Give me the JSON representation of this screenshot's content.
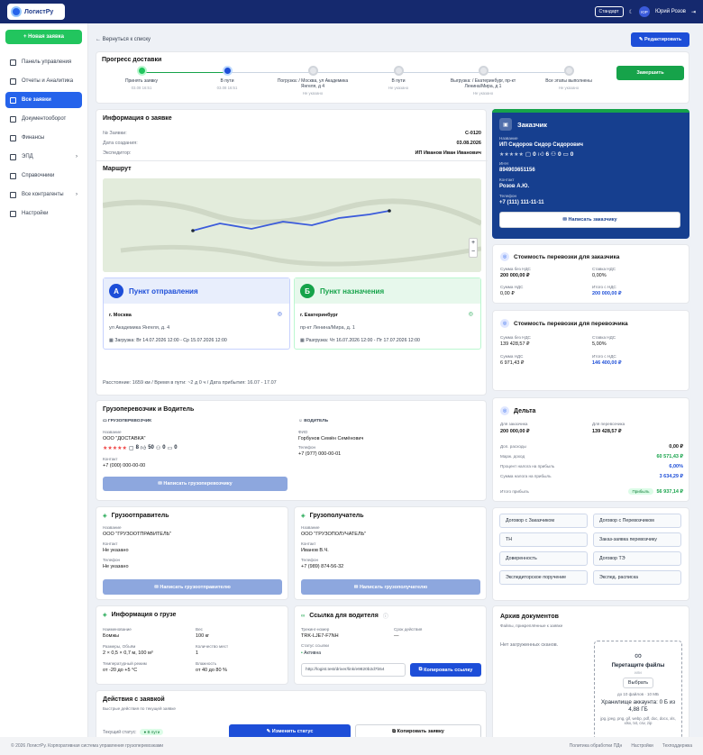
{
  "app": {
    "logo": "ЛогистРу",
    "mode": "Стандарт",
    "user_initials": "ЮР",
    "user_name": "Юрий Розов"
  },
  "sidebar": {
    "new_order": "+ Новая заявка",
    "items": [
      {
        "label": "Панель управления"
      },
      {
        "label": "Отчеты и Аналитика"
      },
      {
        "label": "Все заявки"
      },
      {
        "label": "Документооборот"
      },
      {
        "label": "Финансы"
      },
      {
        "label": "ЭПД"
      },
      {
        "label": "Справочники"
      },
      {
        "label": "Все контрагенты"
      },
      {
        "label": "Настройки"
      }
    ]
  },
  "back": "← Вернуться к списку",
  "edit": "Редактировать",
  "progress": {
    "title": "Прогресс доставки",
    "finish": "Завершить",
    "steps": [
      {
        "title": "Принять заявку",
        "sub": "03.08 16:51"
      },
      {
        "title": "В пути",
        "sub": "03.08 16:51"
      },
      {
        "title": "Погрузка: / Москва, ул Академика Янгеля, д 4",
        "sub": "Не указано"
      },
      {
        "title": "В пути",
        "sub": "Не указано"
      },
      {
        "title": "Выгрузка: / Екатеринбург, пр-кт Ленина/Мира, д 1",
        "sub": "Не указано"
      },
      {
        "title": "Все этапы выполнены",
        "sub": "Не указано"
      }
    ]
  },
  "info": {
    "title": "Информация о заявке",
    "rows": [
      {
        "k": "№ Заявки:",
        "v": "С-0120"
      },
      {
        "k": "Дата создания:",
        "v": "03.08.2026"
      },
      {
        "k": "Экспедитор:",
        "v": "ИП Иванов Иван Иванович"
      }
    ]
  },
  "route": {
    "title": "Маршрут",
    "from_letter": "А",
    "from_title": "Пункт отправления",
    "from_city": "г. Москва",
    "from_addr": "ул Академика Янгеля, д. 4",
    "load": "Загрузка: Вт 14.07.2026 12:00 - Ср 15.07.2026 12:00",
    "to_letter": "Б",
    "to_title": "Пункт назначения",
    "to_city": "г. Екатеринбург",
    "to_addr": "пр-кт Ленина/Мира, д. 1",
    "unload": "Разгрузка: Чт 16.07.2026 12:00 - Пт 17.07.2026 12:00",
    "summary": "Расстояние: 1659 км / Время в пути: ~2 д 0 ч / Дата прибытия: 16.07 - 17.07",
    "zoom_in": "+",
    "zoom_out": "−"
  },
  "customer": {
    "title": "Заказчик",
    "name_lbl": "Название",
    "name": "ИП Сидоров Сидор Сидорович",
    "r0": "0",
    "r1": "6",
    "r2": "0",
    "r3": "0",
    "inn_lbl": "ИНН",
    "inn": "894903651156",
    "contact_lbl": "Контакт",
    "contact": "Розов А.Ю.",
    "phone_lbl": "Телефон",
    "phone": "+7 (111) 111-11-11",
    "write": "Написать заказчику"
  },
  "cost_customer": {
    "title": "Стоимость перевозки для заказчика",
    "a_lbl": "Сумма без НДС",
    "a": "200 000,00 ₽",
    "b_lbl": "Ставка НДС",
    "b": "0,00%",
    "c_lbl": "Сумма НДС",
    "c": "0,00 ₽",
    "d_lbl": "Итого с НДС",
    "d": "200 000,00 ₽"
  },
  "cost_carrier": {
    "title": "Стоимость перевозки для перевозчика",
    "a_lbl": "Сумма без НДС",
    "a": "139 428,57 ₽",
    "b_lbl": "Ставка НДС",
    "b": "5,00%",
    "c_lbl": "Сумма НДС",
    "c": "6 971,43 ₽",
    "d_lbl": "Итого с НДС",
    "d": "146 400,00 ₽"
  },
  "delta": {
    "title": "Дельта",
    "a_lbl": "Для заказчика",
    "a": "200 000,00 ₽",
    "b_lbl": "Для перевозчика",
    "b": "139 428,57 ₽",
    "rows": [
      {
        "k": "Доп. расходы",
        "v": "0,00 ₽"
      },
      {
        "k": "Марж. доход",
        "v": "60 571,43 ₽"
      },
      {
        "k": "Процент налога на прибыль",
        "v": "6,00%"
      },
      {
        "k": "Сумма налога на прибыль",
        "v": "3 634,29 ₽"
      }
    ],
    "total_lbl": "Итого прибыль",
    "badge": "Прибыль",
    "total": "56 937,14 ₽"
  },
  "carrier": {
    "title": "Грузоперевозчик и Водитель",
    "c_head": "ГРУЗОПЕРЕВОЗЧИК",
    "c_name_lbl": "Название",
    "c_name": "ООО \"ДОСТАВКА\"",
    "r1": "8",
    "r2": "50",
    "r3": "0",
    "r4": "0",
    "c_contact_lbl": "Контакт",
    "c_contact": "+7 (000) 000-00-00",
    "d_head": "ВОДИТЕЛЬ",
    "d_fio_lbl": "ФИО",
    "d_fio": "Горбунов Семён Семёнович",
    "d_phone_lbl": "Телефон",
    "d_phone": "+7 (977) 000-00-01",
    "write": "Написать грузоперевозчику"
  },
  "docs": [
    "Договор с Заказчиком",
    "Договор с Перевозчиком",
    "ТН",
    "Заказ-заявка перевозчику",
    "Доверенность",
    "Договор ТЭ",
    "Экспедиторское поручение",
    "Экспед. расписка"
  ],
  "shipper": {
    "title": "Грузоотправитель",
    "n_lbl": "Название",
    "n": "ООО \"ГРУЗООТПРАВИТЕЛЬ\"",
    "c_lbl": "Контакт",
    "c": "Не указано",
    "p_lbl": "Телефон",
    "p": "Не указано",
    "write": "Написать грузоотправителю"
  },
  "consignee": {
    "title": "Грузополучатель",
    "n_lbl": "Название",
    "n": "ООО \"ГРУЗОПОЛУЧАТЕЛЬ\"",
    "c_lbl": "Контакт",
    "c": "Иванов В.Ч.",
    "p_lbl": "Телефон",
    "p": "+7 (989) 874-56-32",
    "write": "Написать грузополучателю"
  },
  "cargo": {
    "title": "Информация о грузе",
    "n_lbl": "Наименование",
    "n": "Бомжы",
    "w_lbl": "Вес",
    "w": "100 кг",
    "s_lbl": "Размеры, Объём",
    "s": "2 × 0,5 × 0,7 м, 100 м³",
    "q_lbl": "Количество мест",
    "q": "1",
    "t_lbl": "Температурный режим",
    "t": "от -20 до +5 °C",
    "h_lbl": "Влажность",
    "h": "от 40 до 80 %"
  },
  "driver_link": {
    "title": "Ссылка для водителя",
    "tn_lbl": "Трекинг-номер",
    "tn": "TRK-LJE7-F7NH",
    "exp_lbl": "Срок действия",
    "exp": "—",
    "st_lbl": "Статус ссылки",
    "st": "Активна",
    "url": "http://logist.test/driver/link/e9820b2d7b54",
    "copy": "Копировать ссылку"
  },
  "archive": {
    "title": "Архив документов",
    "sub": "Файлы, прикреплённые к заявке",
    "empty": "Нет загруженных сканов.",
    "drag": "Перетащите файлы",
    "or": "или",
    "choose": "Выбрать",
    "limit": "до 10 файлов · 10 МБ",
    "storage": "Хранилище аккаунта: 0 Б из 4,88 ГБ",
    "types": "jpg, jpeg, png, gif, webp, pdf, doc, docx, xls, xlsx, txt, csv, zip"
  },
  "actions": {
    "title": "Действия с заявкой",
    "sub": "Быстрые действия по текущей заявке",
    "status_lbl": "Текущий статус:",
    "status": "В пути",
    "change": "Изменить статус",
    "copy": "Копировать заявку"
  },
  "footer": {
    "copy": "© 2026 ЛогистРу. Корпоративная система управления грузоперевозками",
    "links": [
      "Политика обработки ПДн",
      "Настройки",
      "Техподдержка"
    ]
  }
}
